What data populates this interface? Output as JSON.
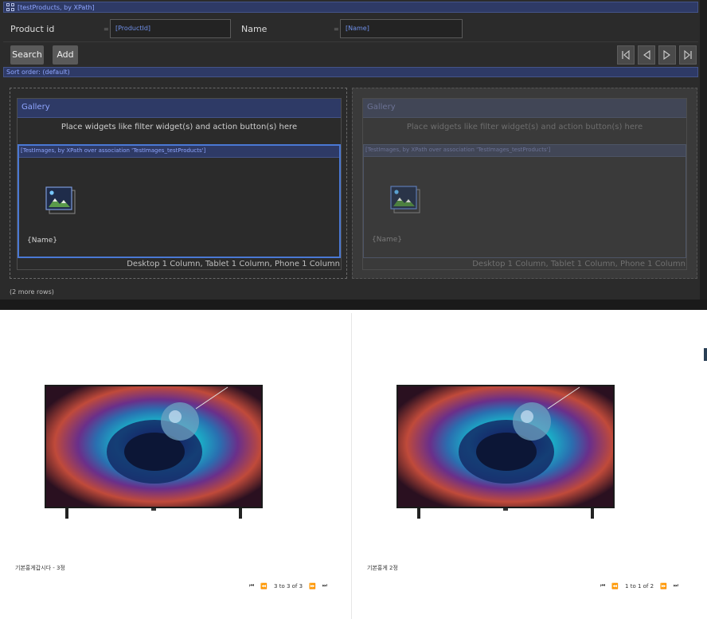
{
  "dataview": {
    "header": "[testProducts, by XPath]"
  },
  "filters": [
    {
      "label": "Product id",
      "operator": "=",
      "value": "[ProductId]"
    },
    {
      "label": "Name",
      "operator": "=",
      "value": "[Name]"
    }
  ],
  "buttons": {
    "search": "Search",
    "add": "Add"
  },
  "sort_order": "Sort order: (default)",
  "gallery_left": {
    "title": "Gallery",
    "placeholder": "Place widgets like filter widget(s) and action button(s) here",
    "list_header": "[TestImages, by XPath over association 'TestImages_testProducts']",
    "item_label": "{Name}",
    "columns": "Desktop 1 Column, Tablet 1 Column, Phone 1 Column"
  },
  "gallery_right": {
    "title": "Gallery",
    "placeholder": "Place widgets like filter widget(s) and action button(s) here",
    "list_header": "[TestImages, by XPath over association 'TestImages_testProducts']",
    "item_label": "{Name}",
    "columns": "Desktop 1 Column, Tablet 1 Column, Phone 1 Column"
  },
  "more_rows": "(2 more rows)",
  "preview": {
    "cards": [
      {
        "caption": "기본홍게갑시다 - 3정",
        "pager": "3 to 3 of 3"
      },
      {
        "caption": "기본홍게 2정",
        "pager": "1 to 1 of 2"
      }
    ]
  },
  "colors": {
    "editor_bg": "#2b2b2b",
    "header_blue": "#2e3a66",
    "accent_text": "#8fa6ff",
    "selection_border": "#4a78d4"
  }
}
